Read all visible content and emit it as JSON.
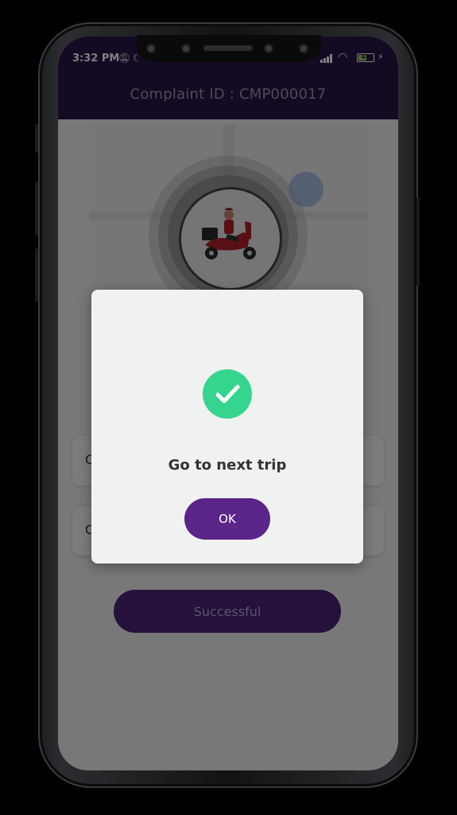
{
  "status_bar": {
    "time": "3:32 PM",
    "battery_level": "49",
    "icons": [
      "bell-off-icon",
      "moon-icon",
      "signal-icon",
      "wifi-icon",
      "battery-icon",
      "charging-icon"
    ]
  },
  "app_bar": {
    "title": "Complaint ID : CMP000017"
  },
  "main": {
    "cards": [
      {
        "label_partial": "C"
      },
      {
        "label_partial": "C"
      }
    ],
    "action_button": "Successful"
  },
  "dialog": {
    "icon": "check-circle-icon",
    "message": "Go to next trip",
    "ok_label": "OK"
  },
  "colors": {
    "app_bar": "#2b1546",
    "accent": "#5a2489",
    "success": "#35d48f"
  }
}
